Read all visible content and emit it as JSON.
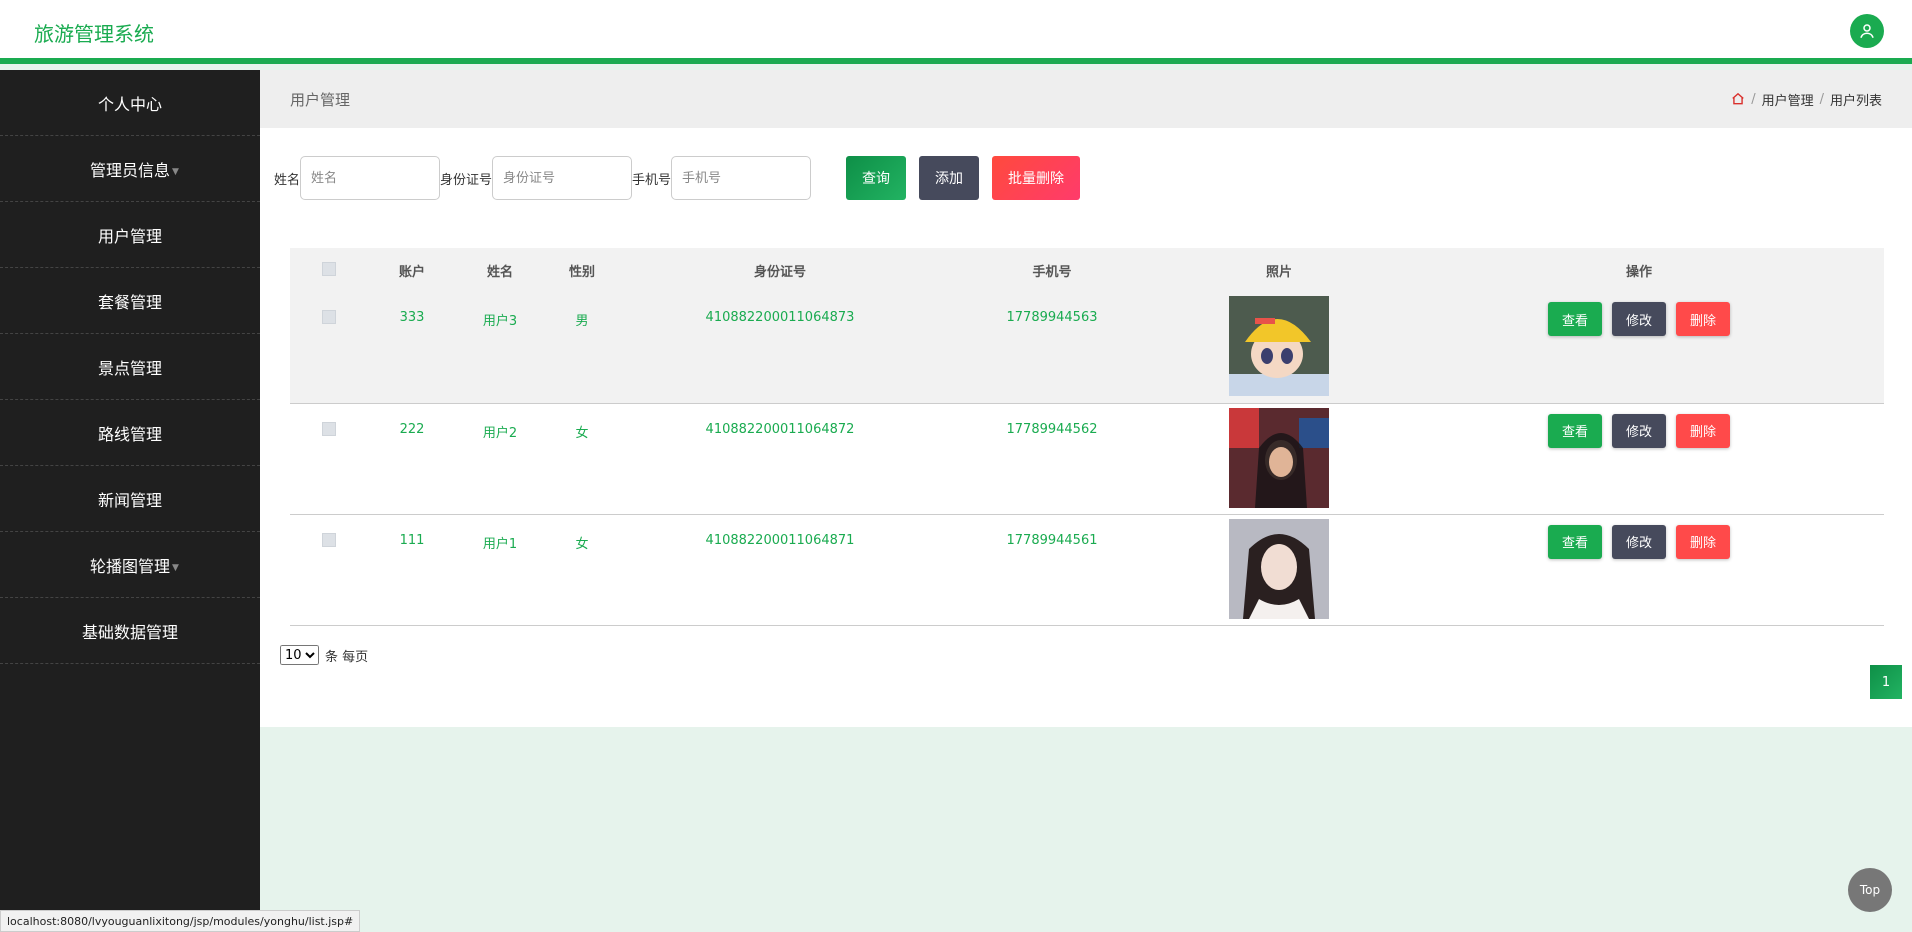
{
  "app": {
    "title": "旅游管理系统"
  },
  "sidebar": {
    "items": [
      {
        "label": "个人中心"
      },
      {
        "label": "管理员信息"
      },
      {
        "label": "用户管理"
      },
      {
        "label": "套餐管理"
      },
      {
        "label": "景点管理"
      },
      {
        "label": "路线管理"
      },
      {
        "label": "新闻管理"
      },
      {
        "label": "轮播图管理"
      },
      {
        "label": "基础数据管理"
      }
    ]
  },
  "page": {
    "title": "用户管理",
    "breadcrumb": [
      "用户管理",
      "用户列表"
    ]
  },
  "filters": {
    "name_label": "姓名",
    "name_placeholder": "姓名",
    "idcard_label": "身份证号",
    "idcard_placeholder": "身份证号",
    "phone_label": "手机号",
    "phone_placeholder": "手机号",
    "search_label": "查询",
    "add_label": "添加",
    "batch_delete_label": "批量删除"
  },
  "table": {
    "columns": [
      "账户",
      "姓名",
      "性别",
      "身份证号",
      "手机号",
      "照片",
      "操作"
    ],
    "rows": [
      {
        "account": "333",
        "name": "用户3",
        "gender": "男",
        "idcard": "410882200011064873",
        "phone": "17789944563"
      },
      {
        "account": "222",
        "name": "用户2",
        "gender": "女",
        "idcard": "410882200011064872",
        "phone": "17789944562"
      },
      {
        "account": "111",
        "name": "用户1",
        "gender": "女",
        "idcard": "410882200011064871",
        "phone": "17789944561"
      }
    ],
    "actions": {
      "view": "查看",
      "edit": "修改",
      "delete": "删除"
    }
  },
  "pagination": {
    "page_size": "10",
    "per_page_text": "条 每页",
    "current_page": "1"
  },
  "statusbar": {
    "url": "localhost:8080/lvyouguanlixitong/jsp/modules/yonghu/list.jsp#"
  },
  "top_button": "Top",
  "colors": {
    "accent": "#1aab50",
    "sidebar": "#1f1f1f",
    "danger": "#ff4a4a",
    "neutral": "#464a5c"
  }
}
